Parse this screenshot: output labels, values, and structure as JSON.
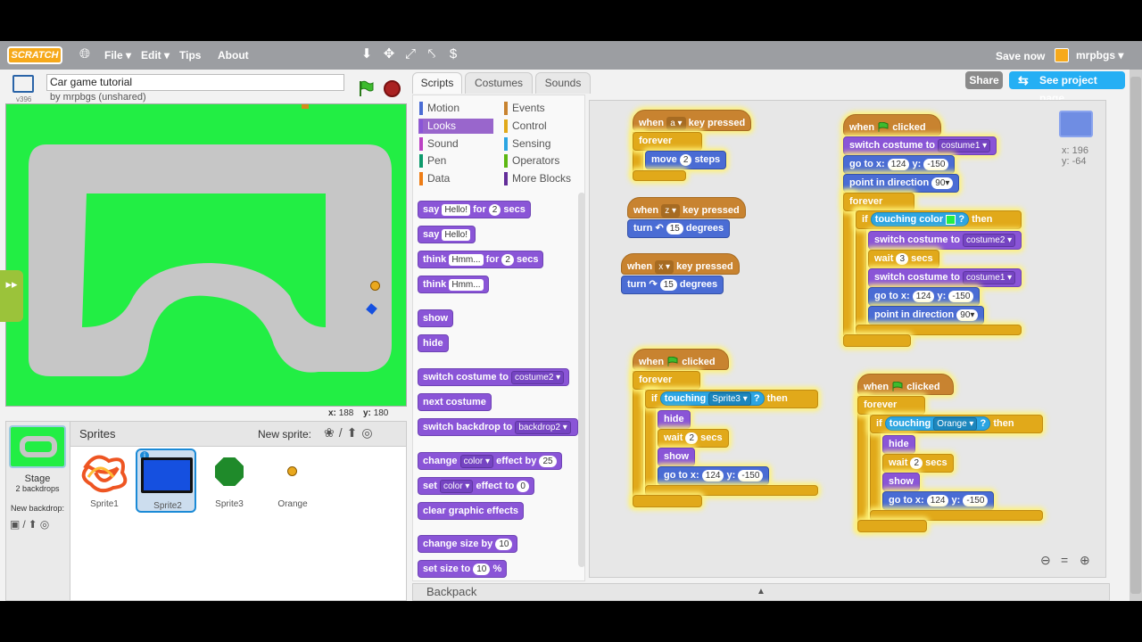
{
  "menubar": {
    "logo": "SCRATCH",
    "items": [
      "File ▾",
      "Edit ▾",
      "Tips",
      "About"
    ],
    "save_now": "Save now",
    "username": "mrpbgs ▾"
  },
  "project": {
    "title": "Car game tutorial",
    "byline": "by mrpbgs (unshared)",
    "version": "v396"
  },
  "stage_coords": {
    "x_label": "x:",
    "x_value": "188",
    "y_label": "y:",
    "y_value": "180"
  },
  "sprites_panel": {
    "title": "Sprites",
    "new_sprite": "New sprite:",
    "stage_label": "Stage",
    "stage_sub": "2 backdrops",
    "new_backdrop": "New backdrop:",
    "sprites": [
      {
        "name": "Sprite1"
      },
      {
        "name": "Sprite2",
        "selected": true
      },
      {
        "name": "Sprite3"
      },
      {
        "name": "Orange"
      }
    ]
  },
  "tabs": [
    "Scripts",
    "Costumes",
    "Sounds"
  ],
  "active_tab": "Scripts",
  "buttons": {
    "share": "Share",
    "see_project": "See project page"
  },
  "categories": [
    {
      "label": "Motion",
      "color": "#4a6cd4"
    },
    {
      "label": "Looks",
      "color": "#8a55d7",
      "selected": true
    },
    {
      "label": "Sound",
      "color": "#bb42c3"
    },
    {
      "label": "Pen",
      "color": "#0e9a6c"
    },
    {
      "label": "Data",
      "color": "#ee7d16"
    },
    {
      "label": "Events",
      "color": "#c88330"
    },
    {
      "label": "Control",
      "color": "#e1a91a"
    },
    {
      "label": "Sensing",
      "color": "#2ca5e2"
    },
    {
      "label": "Operators",
      "color": "#5cb712"
    },
    {
      "label": "More Blocks",
      "color": "#632d99"
    }
  ],
  "palette": {
    "say_for": {
      "a": "say",
      "b": "Hello!",
      "c": "for",
      "d": "2",
      "e": "secs"
    },
    "say": {
      "a": "say",
      "b": "Hello!"
    },
    "think_for": {
      "a": "think",
      "b": "Hmm...",
      "c": "for",
      "d": "2",
      "e": "secs"
    },
    "think": {
      "a": "think",
      "b": "Hmm..."
    },
    "show": "show",
    "hide": "hide",
    "switch_costume": {
      "a": "switch costume to",
      "b": "costume2 ▾"
    },
    "next_costume": "next costume",
    "switch_backdrop": {
      "a": "switch backdrop to",
      "b": "backdrop2 ▾"
    },
    "change_effect": {
      "a": "change",
      "b": "color ▾",
      "c": "effect by",
      "d": "25"
    },
    "set_effect": {
      "a": "set",
      "b": "color ▾",
      "c": "effect to",
      "d": "0"
    },
    "clear_effects": "clear graphic effects",
    "change_size": {
      "a": "change size by",
      "b": "10"
    },
    "set_size": {
      "a": "set size to",
      "b": "10",
      "c": "%"
    }
  },
  "scripts": {
    "s1": {
      "when": "when",
      "key": "a ▾",
      "pressed": "key pressed",
      "forever": "forever",
      "move": "move",
      "steps_val": "2",
      "steps": "steps"
    },
    "s2": {
      "when": "when",
      "key": "z ▾",
      "pressed": "key pressed",
      "turn": "turn ↶",
      "deg_val": "15",
      "deg": "degrees"
    },
    "s3": {
      "when": "when",
      "key": "x ▾",
      "pressed": "key pressed",
      "turn": "turn ↷",
      "deg_val": "15",
      "deg": "degrees"
    },
    "s4": {
      "when": "when",
      "clicked": "clicked",
      "switch1": "switch costume to",
      "costume1": "costume1 ▾",
      "goto": "go to x:",
      "x": "124",
      "ylab": "y:",
      "y": "-150",
      "point": "point in direction",
      "dir": "90▾",
      "forever": "forever",
      "if": "if",
      "touching": "touching color",
      "q": "?",
      "then": "then",
      "switch2": "switch costume to",
      "costume2": "costume2 ▾",
      "wait": "wait",
      "wait_val": "3",
      "secs": "secs",
      "switch3": "switch costume to",
      "costume1b": "costume1 ▾",
      "goto2": "go to x:",
      "x2": "124",
      "ylab2": "y:",
      "y2": "-150",
      "point2": "point in direction",
      "dir2": "90▾"
    },
    "s5": {
      "when": "when",
      "clicked": "clicked",
      "forever": "forever",
      "if": "if",
      "touching": "touching",
      "target": "Sprite3 ▾",
      "q": "?",
      "then": "then",
      "hide": "hide",
      "wait": "wait",
      "wait_val": "2",
      "secs": "secs",
      "show": "show",
      "goto": "go to x:",
      "x": "124",
      "ylab": "y:",
      "y": "-150"
    },
    "s6": {
      "when": "when",
      "clicked": "clicked",
      "forever": "forever",
      "if": "if",
      "touching": "touching",
      "target": "Orange ▾",
      "q": "?",
      "then": "then",
      "hide": "hide",
      "wait": "wait",
      "wait_val": "2",
      "secs": "secs",
      "show": "show",
      "goto": "go to x:",
      "x": "124",
      "ylab": "y:",
      "y": "-150"
    }
  },
  "sprite_info": {
    "x": "x: 196",
    "y": "y: -64"
  },
  "backpack": "Backpack"
}
